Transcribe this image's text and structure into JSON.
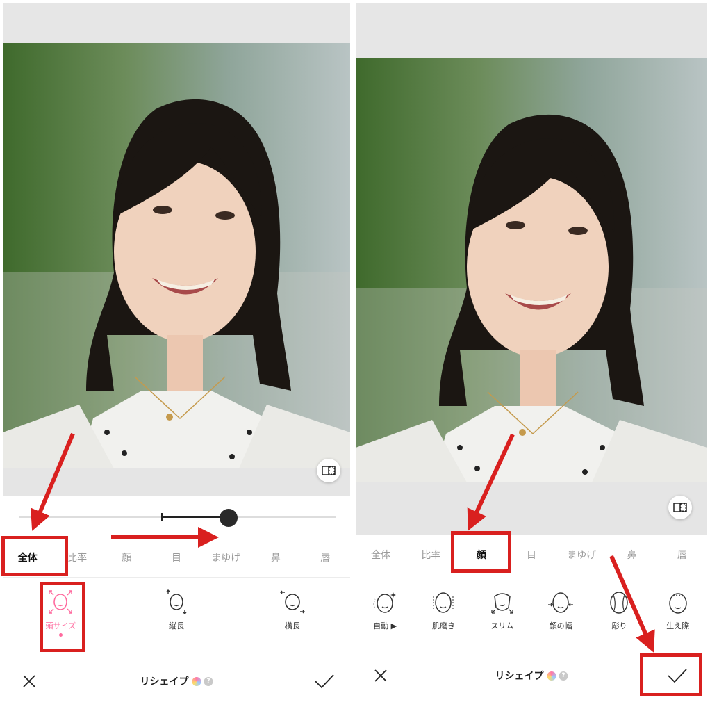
{
  "left": {
    "tabs": [
      "全体",
      "比率",
      "顔",
      "目",
      "まゆげ",
      "鼻",
      "唇"
    ],
    "active_tab": "全体",
    "tools": [
      {
        "label": "頭サイズ",
        "icon": "head-size-icon",
        "active": true
      },
      {
        "label": "縦長",
        "icon": "vertical-stretch-icon",
        "active": false
      },
      {
        "label": "横長",
        "icon": "horizontal-stretch-icon",
        "active": false
      }
    ],
    "slider_value": 0.6,
    "title": "リシェイプ"
  },
  "right": {
    "tabs": [
      "全体",
      "比率",
      "顔",
      "目",
      "まゆげ",
      "鼻",
      "唇"
    ],
    "active_tab": "顔",
    "tools": [
      {
        "label": "自動 ▶",
        "icon": "auto-face-icon"
      },
      {
        "label": "肌磨き",
        "icon": "skin-smooth-icon"
      },
      {
        "label": "スリム",
        "icon": "slim-face-icon"
      },
      {
        "label": "顔の幅",
        "icon": "face-width-icon"
      },
      {
        "label": "彫り",
        "icon": "contour-icon"
      },
      {
        "label": "生え際",
        "icon": "hairline-icon"
      }
    ],
    "title": "リシェイプ"
  },
  "colors": {
    "annotation_red": "#d9201f",
    "accent_pink": "#ff6a9e",
    "sheet_bg": "#ffffff",
    "strip_gray": "#e5e5e5"
  }
}
